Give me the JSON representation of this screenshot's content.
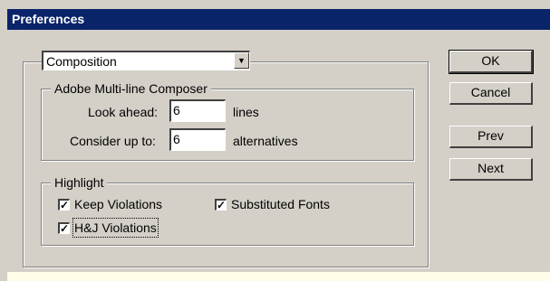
{
  "window": {
    "title": "Preferences"
  },
  "section_dropdown": {
    "value": "Composition",
    "arrow_icon": "chevron-down-icon"
  },
  "composer": {
    "legend": "Adobe Multi-line Composer",
    "look_ahead_label": "Look ahead:",
    "look_ahead_value": "6",
    "look_ahead_unit": "lines",
    "consider_label": "Consider up to:",
    "consider_value": "6",
    "consider_unit": "alternatives"
  },
  "highlight": {
    "legend": "Highlight",
    "keep_violations": {
      "label": "Keep Violations",
      "checked": true
    },
    "hj_violations": {
      "label": "H&J Violations",
      "checked": true
    },
    "substituted_fonts": {
      "label": "Substituted Fonts",
      "checked": true
    }
  },
  "buttons": {
    "ok": "OK",
    "cancel": "Cancel",
    "prev": "Prev",
    "next": "Next"
  }
}
